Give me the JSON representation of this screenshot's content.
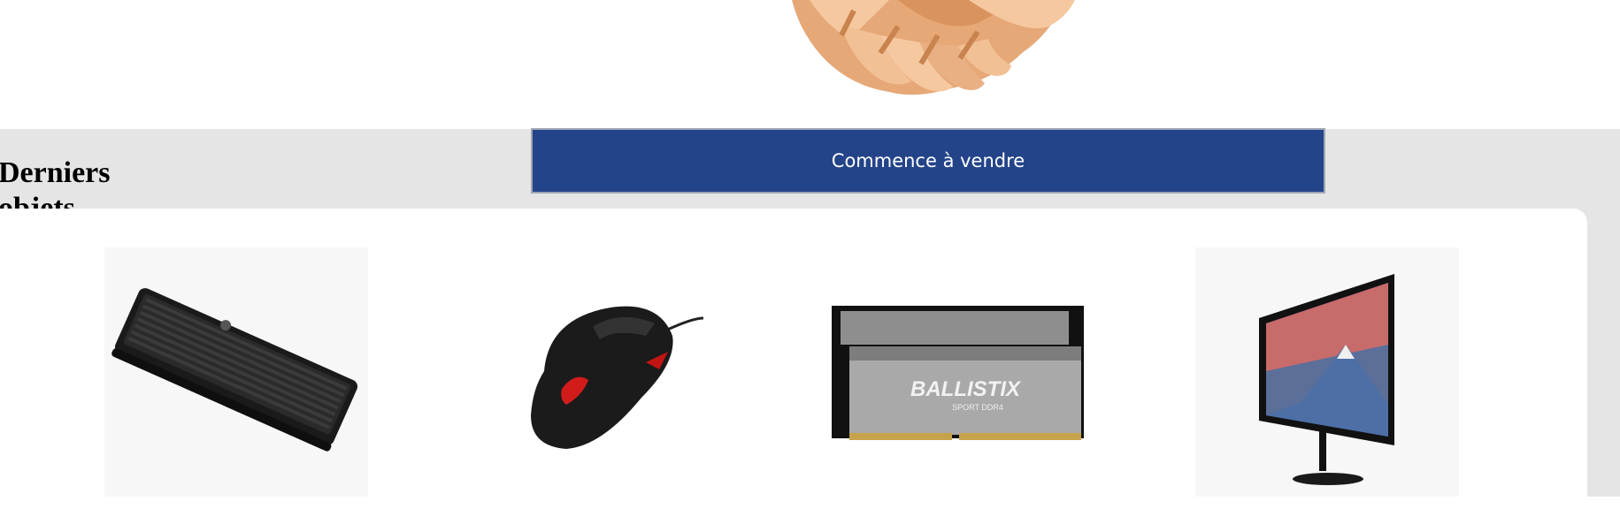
{
  "hero": {
    "image_icon": "handshake-icon"
  },
  "actions": {
    "start_selling_label": "Commence à vendre"
  },
  "latest": {
    "title": "Derniers objets",
    "products": [
      {
        "icon": "keyboard-icon"
      },
      {
        "icon": "mouse-icon"
      },
      {
        "icon": "ram-memory-icon",
        "brand_lettering": "BALLISTIX SPORT DDR4"
      },
      {
        "icon": "monitor-icon"
      }
    ]
  },
  "colors": {
    "button_bg": "#24448a",
    "band_bg": "#e5e5e5",
    "skin": "#f2c095"
  }
}
